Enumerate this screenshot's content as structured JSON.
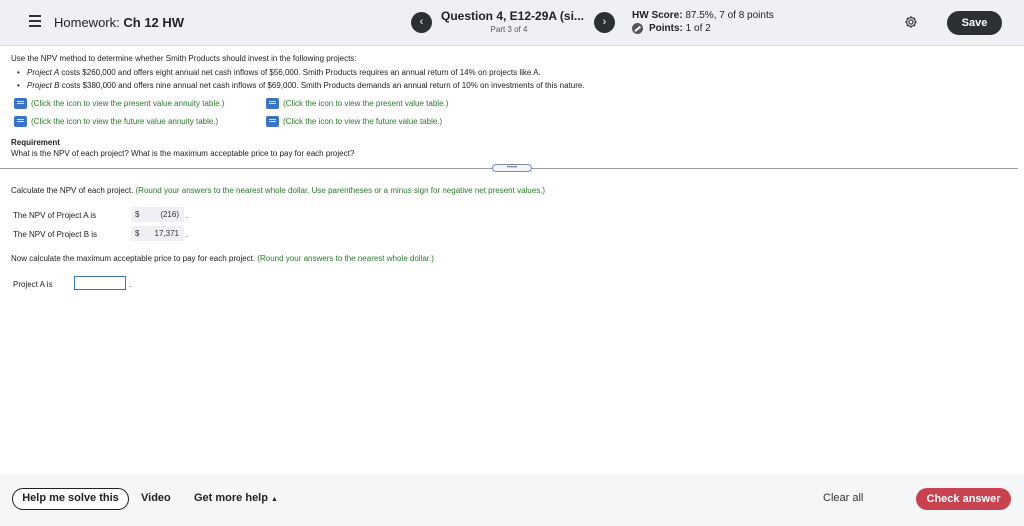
{
  "header": {
    "homework_prefix": "Homework:",
    "homework_name": "Ch 12 HW",
    "question_title": "Question 4, E12-29A (si...",
    "question_part": "Part 3 of 4",
    "score_label": "HW Score:",
    "score_value": "87.5%, 7 of 8 points",
    "points_label": "Points:",
    "points_value": "1 of 2",
    "save_label": "Save",
    "prev_symbol": "‹",
    "next_symbol": "›"
  },
  "problem": {
    "intro": "Use the NPV method to determine whether Smith Products should invest in the following projects:",
    "project_a_name": "Project A",
    "project_a_text": " costs $260,000 and offers eight annual net cash inflows of $56,000. Smith Products requires an annual return of 14% on projects like A.",
    "project_b_name": "Project B",
    "project_b_text": " costs $380,000 and offers nine annual net cash inflows of $69,000. Smith Products demands an annual return of 10% on investments of this nature.",
    "links": {
      "pv_annuity": "(Click the icon to view the present value annuity table.)",
      "pv_table": "(Click the icon to view the present value table.)",
      "fv_annuity": "(Click the icon to view the future value annuity table.)",
      "fv_table": "(Click the icon to view the future value table.)"
    },
    "requirement_title": "Requirement",
    "requirement_text": "What is the NPV of each project? What is the maximum acceptable price to pay for each project?"
  },
  "expander_label": "•••••",
  "part1": {
    "instruction": "Calculate the NPV of each project. ",
    "hint": "(Round your answers to the nearest whole dollar. Use parentheses or a minus sign for negative net present values.)",
    "npv_a_label": "The NPV of Project A is",
    "npv_a_currency": "$",
    "npv_a_value": "(216)",
    "npv_b_label": "The NPV of Project B is",
    "npv_b_currency": "$",
    "npv_b_value": "17,371",
    "period": "."
  },
  "part2": {
    "instruction": "Now calculate the maximum acceptable price to pay for each project. ",
    "hint": "(Round your answers to the nearest whole dollar.)",
    "project_a_label": "Project A is",
    "project_a_value": "",
    "period": "."
  },
  "footer": {
    "help_label": "Help me solve this",
    "video_label": "Video",
    "more_help_label": "Get more help",
    "clear_label": "Clear all",
    "check_label": "Check answer"
  },
  "colors": {
    "accent_green": "#2b7a2b",
    "check_button": "#c9424f",
    "dark_button": "#2c2f33",
    "input_border": "#3b74c7"
  }
}
